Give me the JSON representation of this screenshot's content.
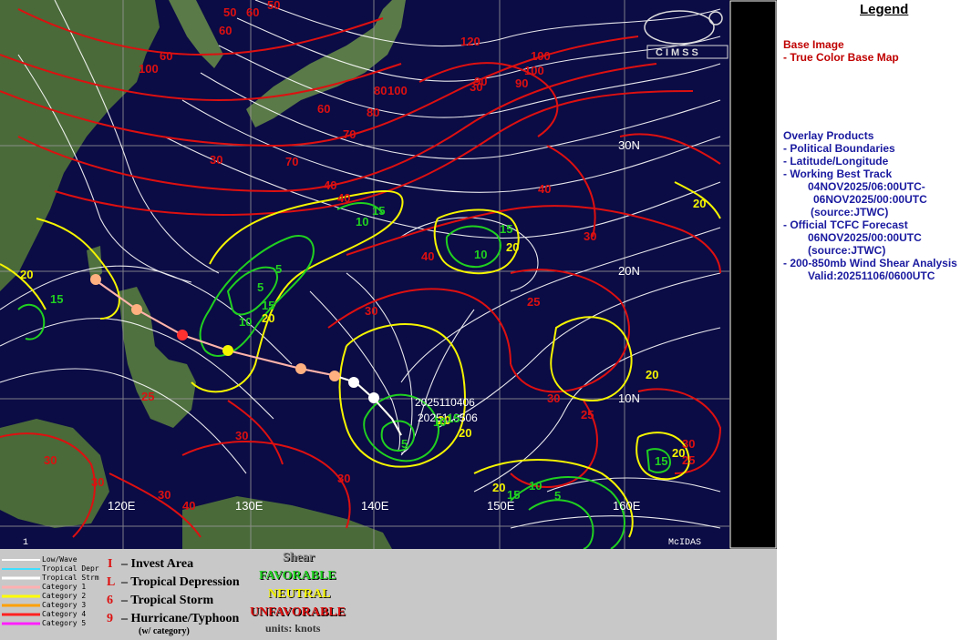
{
  "map": {
    "lat_labels": [
      "30N",
      "20N",
      "10N"
    ],
    "lon_labels": [
      "120E",
      "130E",
      "140E",
      "150E",
      "160E"
    ],
    "frame_number": "1",
    "mcidas_label": "McIDAS",
    "logo_text": "CIMSS",
    "storm_labels": [
      "2025110406",
      "2025110506"
    ],
    "contour_labels": {
      "red": [
        "50",
        "60",
        "60",
        "60",
        "50",
        "100",
        "50",
        "100",
        "60",
        "80",
        "70",
        "70",
        "30",
        "40",
        "40",
        "40",
        "40",
        "30",
        "25",
        "30",
        "30",
        "25",
        "30",
        "30",
        "25",
        "30",
        "30",
        "30",
        "40",
        "30",
        "25",
        "30",
        "30",
        "100",
        "120",
        "100",
        "90",
        "80",
        "90",
        "40"
      ],
      "yellow": [
        "20",
        "20",
        "20",
        "20",
        "20",
        "20",
        "20",
        "20",
        "20"
      ],
      "green": [
        "15",
        "15",
        "10",
        "5",
        "5",
        "15",
        "10",
        "15",
        "10",
        "15",
        "10",
        "15",
        "5",
        "15",
        "10",
        "15",
        "5"
      ]
    },
    "colors": {
      "ocean": "#0b0b45",
      "land": "#4a6a3a",
      "shear_red": "#dd1010",
      "shear_yellow": "#f5f500",
      "shear_green": "#20d020",
      "streamline": "#ffffff",
      "grid": "#9a9a9a"
    }
  },
  "legend": {
    "title": "Legend",
    "base_image_header": "Base Image",
    "base_image_item": "-  True Color Base Map",
    "overlay_header": "Overlay Products",
    "overlay_items": [
      "-  Political Boundaries",
      "-  Latitude/Longitude",
      "-  Working Best Track",
      "04NOV2025/06:00UTC-",
      "06NOV2025/00:00UTC",
      "(source:JTWC)",
      "-  Official TCFC Forecast",
      "06NOV2025/00:00UTC",
      "(source:JTWC)",
      "-  200-850mb Wind Shear Analysis",
      "Valid:20251106/0600UTC"
    ]
  },
  "key": {
    "track_types": [
      "Low/Wave",
      "Tropical Depr",
      "Tropical Strm",
      "Category 1",
      "Category 2",
      "Category 3",
      "Category 4",
      "Category 5"
    ],
    "track_colors": [
      "#ffffff",
      "#40e0ff",
      "#ffffff",
      "#ffb0b0",
      "#ffff00",
      "#ffa000",
      "#ff2020",
      "#ff20ff"
    ],
    "symbols": [
      {
        "glyph": "I",
        "label": "– Invest Area"
      },
      {
        "glyph": "L",
        "label": "– Tropical Depression"
      },
      {
        "glyph": "6",
        "label": "– Tropical Storm"
      },
      {
        "glyph": "9",
        "label": "– Hurricane/Typhoon"
      }
    ],
    "category_note": "(w/ category)",
    "shear_header": "Shear",
    "favorable": "FAVORABLE",
    "neutral": "NEUTRAL",
    "unfavorable": "UNFAVORABLE",
    "units": "units: knots"
  }
}
